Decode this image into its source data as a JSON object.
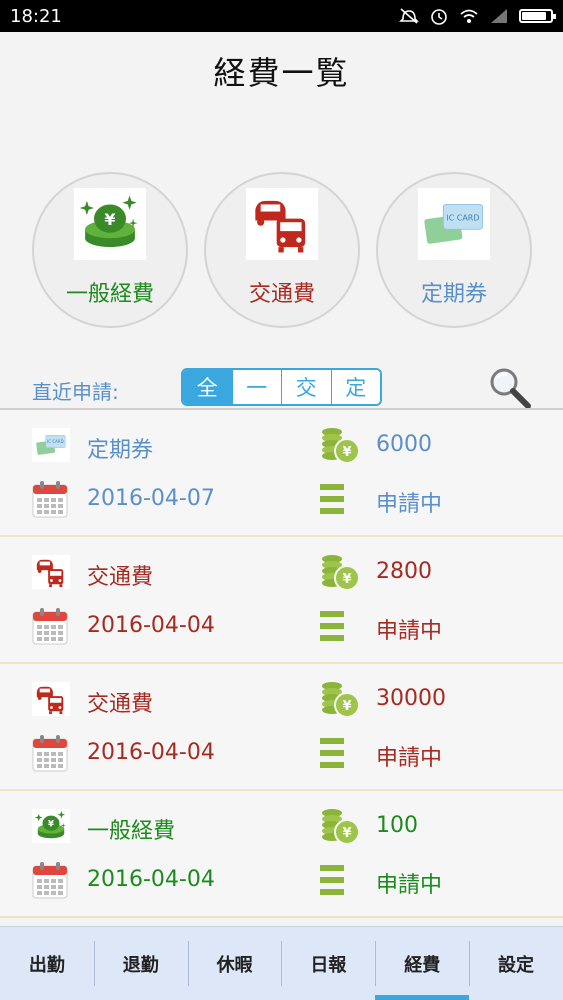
{
  "status_bar": {
    "time": "18:21",
    "battery_level": 0.85
  },
  "page": {
    "title": "経費一覧"
  },
  "categories": [
    {
      "label": "一般経費",
      "icon": "yen-coins-icon",
      "color": "#1d8a1d"
    },
    {
      "label": "交通費",
      "icon": "car-bus-icon",
      "color": "#a52b22"
    },
    {
      "label": "定期券",
      "icon": "ic-card-icon",
      "color": "#5b8fc9"
    }
  ],
  "filter": {
    "label": "直近申請:",
    "options": [
      "全",
      "一",
      "交",
      "定"
    ],
    "selected": "全",
    "search_icon": "magnifier-icon"
  },
  "records": [
    {
      "type": "定期券",
      "amount": "6000",
      "date": "2016-04-07",
      "status": "申請中",
      "color": "#5b8fc9",
      "icon": "ic-card-icon"
    },
    {
      "type": "交通費",
      "amount": "2800",
      "date": "2016-04-04",
      "status": "申請中",
      "color": "#a52b22",
      "icon": "car-bus-icon"
    },
    {
      "type": "交通費",
      "amount": "30000",
      "date": "2016-04-04",
      "status": "申請中",
      "color": "#a52b22",
      "icon": "car-bus-icon"
    },
    {
      "type": "一般経費",
      "amount": "100",
      "date": "2016-04-04",
      "status": "申請中",
      "color": "#1d8a1d",
      "icon": "yen-coins-icon"
    }
  ],
  "nav": {
    "items": [
      "出勤",
      "退勤",
      "休暇",
      "日報",
      "経費",
      "設定"
    ],
    "active": "経費"
  },
  "colors": {
    "accent": "#3ba7df",
    "green": "#1d8a1d",
    "red": "#a52b22",
    "blue": "#5b8fc9",
    "olive": "#8bb43a"
  }
}
